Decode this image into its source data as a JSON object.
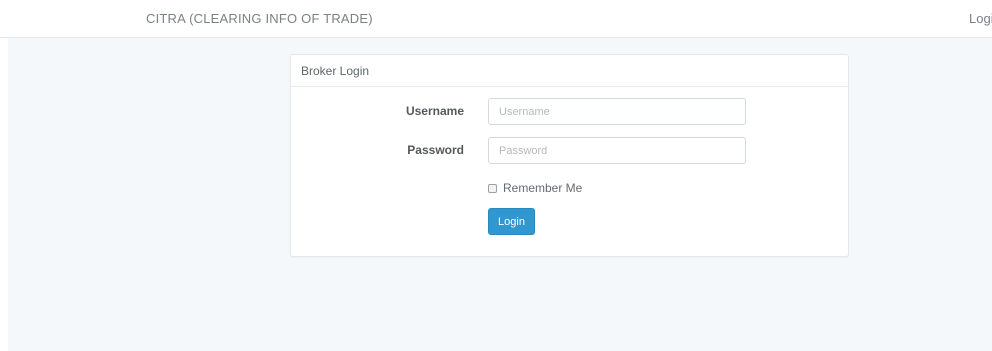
{
  "navbar": {
    "brand": "CITRA (CLEARING INFO OF TRADE)",
    "login_link": "Login"
  },
  "panel": {
    "heading": "Broker Login",
    "username": {
      "label": "Username",
      "placeholder": "Username",
      "value": ""
    },
    "password": {
      "label": "Password",
      "placeholder": "Password",
      "value": ""
    },
    "remember_label": "Remember Me",
    "submit_label": "Login"
  },
  "colors": {
    "primary": "#3097d1",
    "page_background": "#f5f8fa"
  }
}
